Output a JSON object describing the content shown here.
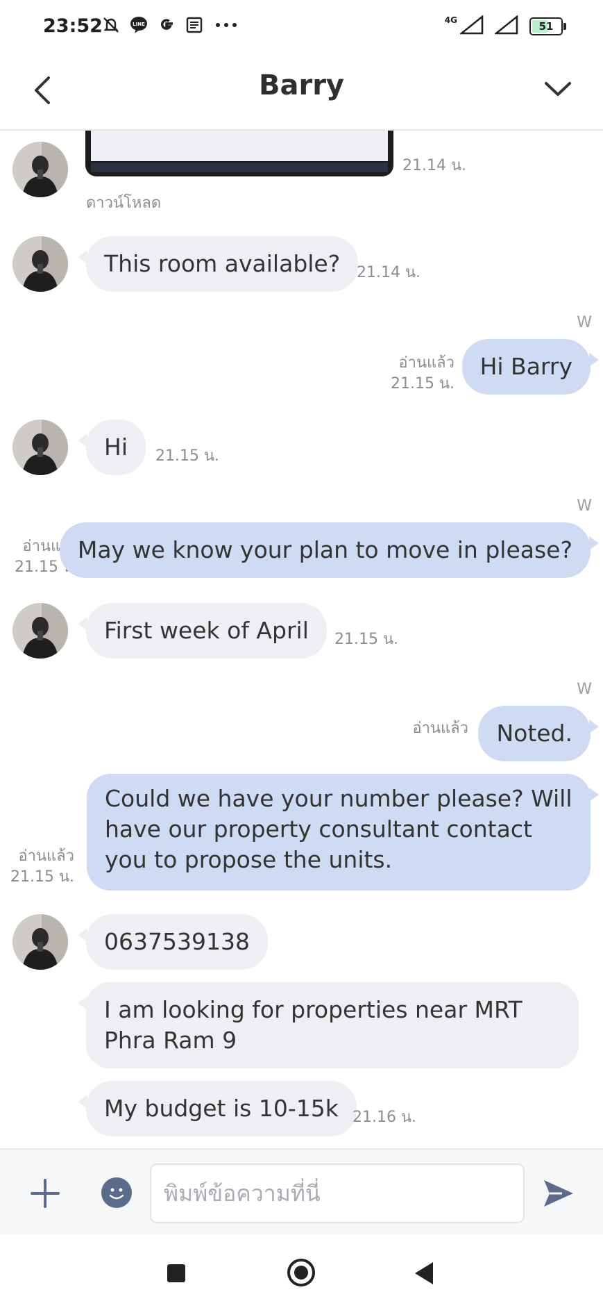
{
  "status_bar": {
    "time": "23:52",
    "network": "4G",
    "battery": "51",
    "icons": [
      "mute-bell-icon",
      "line-icon",
      "google-icon",
      "news-icon",
      "more-dots-icon",
      "signal-icon",
      "signal-icon",
      "battery-icon"
    ]
  },
  "header": {
    "title": "Barry",
    "icons": [
      "back-chevron-icon",
      "chevron-down-icon"
    ]
  },
  "messages": {
    "m0": {
      "time": "21.14 น.",
      "download": "ดาวน์โหลด"
    },
    "m1": {
      "text": "This room available?",
      "time": "21.14 น."
    },
    "m2": {
      "sender": "W",
      "text": "Hi Barry",
      "read": "อ่านแล้ว",
      "time": "21.15 น."
    },
    "m3": {
      "text": "Hi",
      "time": "21.15 น."
    },
    "m4": {
      "sender": "W",
      "text": "May we know your plan to move in please?",
      "read": "อ่านแล้ว",
      "time": "21.15 น."
    },
    "m5": {
      "text": "First week of April",
      "time": "21.15 น."
    },
    "m6": {
      "sender": "W",
      "text": "Noted.",
      "read": "อ่านแล้ว"
    },
    "m7": {
      "text": "Could we have your number please? Will have our property consultant contact you to propose the units.",
      "read": "อ่านแล้ว",
      "time": "21.15 น."
    },
    "m8": {
      "text": "0637539138"
    },
    "m9": {
      "text": "I am looking for properties near MRT Phra Ram 9"
    },
    "m10": {
      "text": "My budget is 10-15k",
      "time": "21.16 น."
    }
  },
  "input_bar": {
    "placeholder": "พิมพ์ข้อความที่นี่",
    "icons": [
      "plus-icon",
      "emoji-icon",
      "send-icon"
    ]
  },
  "colors": {
    "incoming_bubble": "#eeeff2",
    "outgoing_bubble": "#cfdbf3",
    "meta_text": "#8a8d93"
  }
}
